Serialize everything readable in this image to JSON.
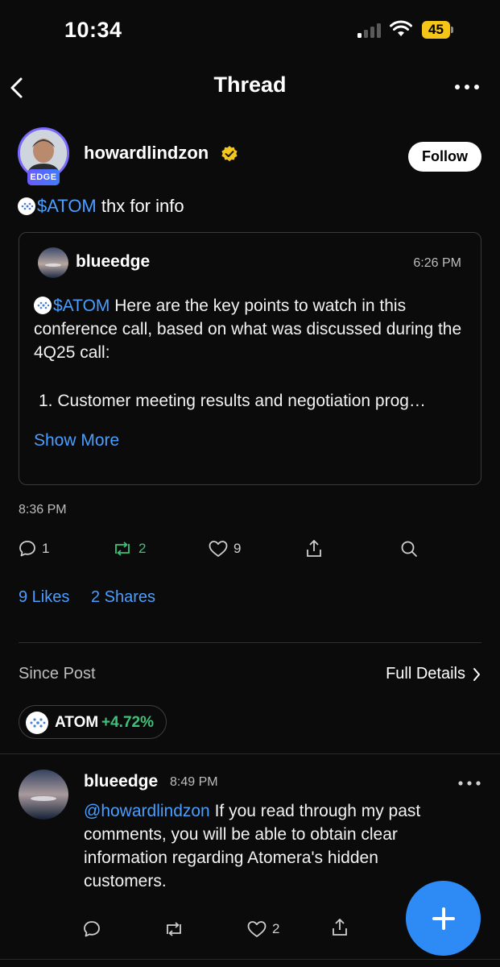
{
  "status_bar": {
    "time": "10:34",
    "battery": "45"
  },
  "nav": {
    "title": "Thread"
  },
  "post": {
    "username": "howardlindzon",
    "badge": "EDGE",
    "follow_label": "Follow",
    "cashtag": "$ATOM",
    "text": " thx for info",
    "time": "8:36 PM",
    "actions": {
      "comments": "1",
      "reshares": "2",
      "likes": "9"
    },
    "stats": {
      "likes": "9 Likes",
      "shares": "2 Shares"
    }
  },
  "quote": {
    "username": "blueedge",
    "time": "6:26 PM",
    "cashtag": "$ATOM",
    "text": " Here are the key points to watch in this conference call, based on what was discussed during the 4Q25 call:",
    "list_item": "1. Customer meeting results and negotiation prog…",
    "show_more": "Show More"
  },
  "since_post": {
    "label": "Since Post",
    "full_details": "Full Details",
    "ticker": {
      "symbol": "ATOM",
      "change": "+4.72%"
    }
  },
  "reply": {
    "username": "blueedge",
    "time": "8:49 PM",
    "mention": "@howardlindzon",
    "text": " If you read through my past comments, you will be able to obtain clear information regarding Atomera's hidden customers.",
    "actions": {
      "likes": "2"
    }
  },
  "colors": {
    "accent": "#4a9eff",
    "positive": "#3ec27a",
    "fab": "#2e8bf5",
    "verified": "#f5c518",
    "badge": "#6a5cff"
  }
}
